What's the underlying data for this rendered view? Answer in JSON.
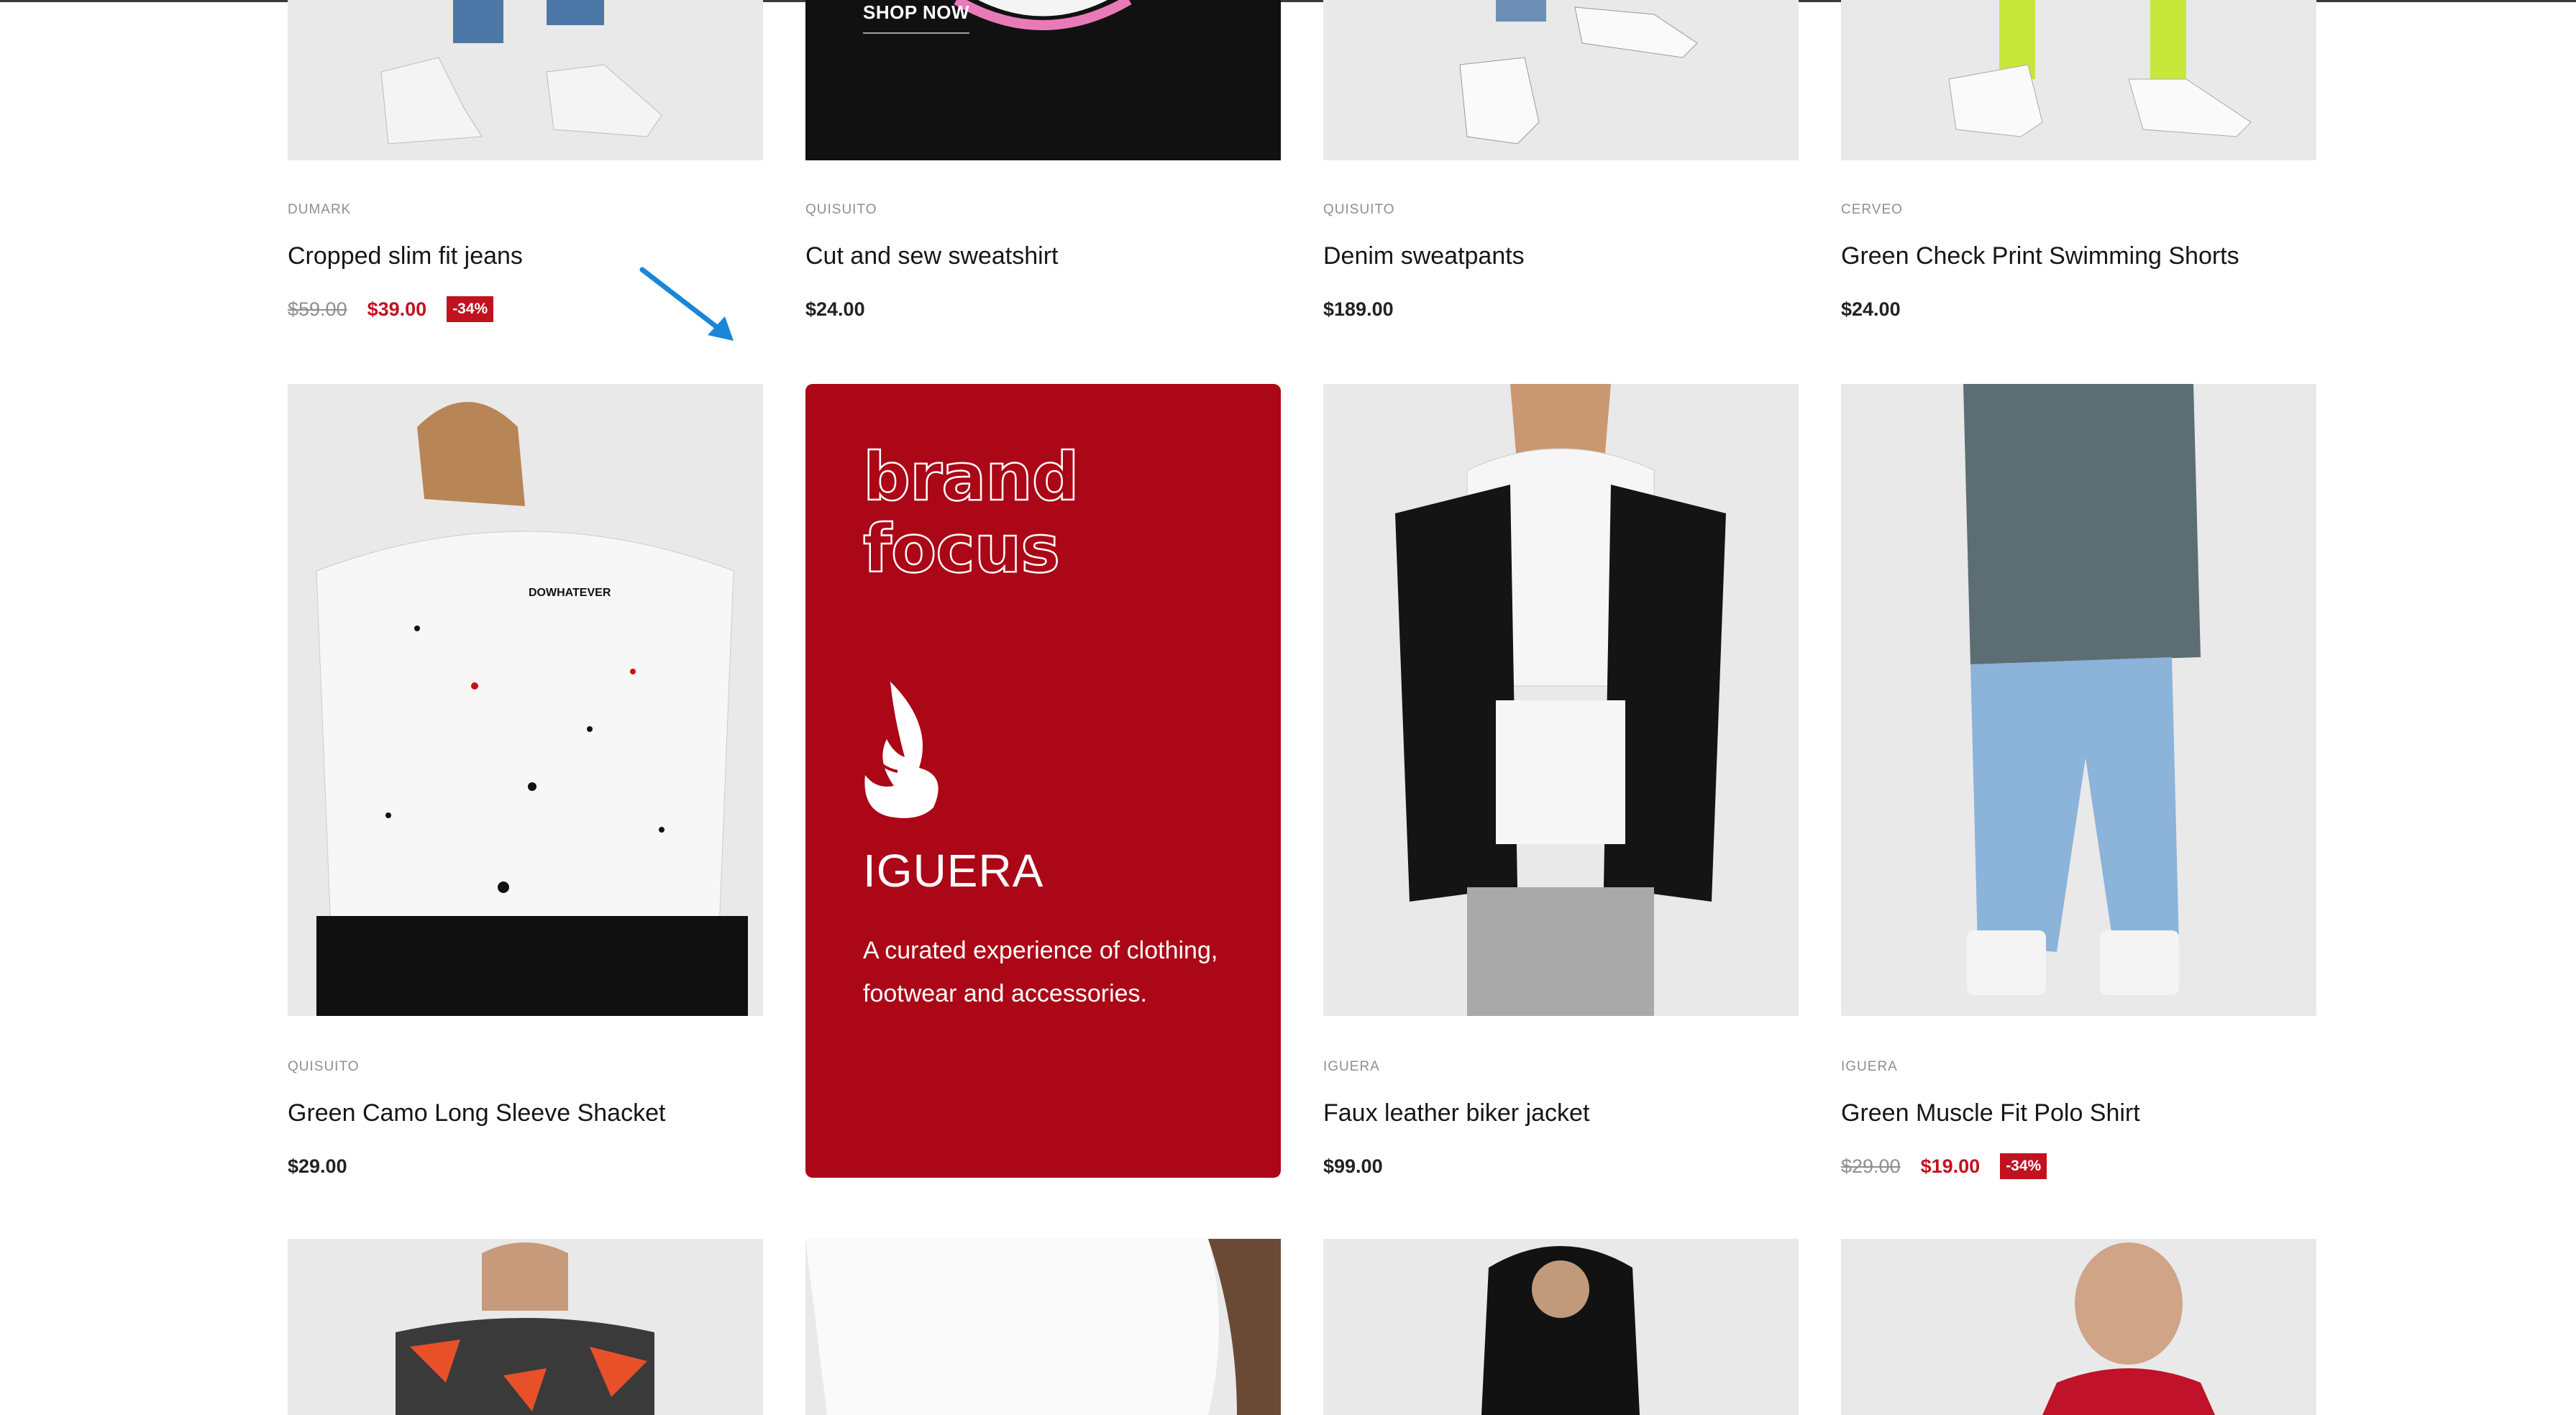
{
  "row1": [
    {
      "brand": "DUMARK",
      "title": "Cropped slim fit jeans",
      "old_price": "$59.00",
      "price": "$39.00",
      "badge": "-34%"
    },
    {
      "brand": "QUISUITO",
      "title": "Cut and sew sweatshirt",
      "price": "$24.00"
    },
    {
      "brand": "QUISUITO",
      "title": "Denim sweatpants",
      "price": "$189.00"
    },
    {
      "brand": "CERVEO",
      "title": "Green Check Print Swimming Shorts",
      "price": "$24.00"
    }
  ],
  "row2": [
    {
      "brand": "QUISUITO",
      "title": "Green Camo Long Sleeve Shacket",
      "price": "$29.00"
    },
    {
      "brand": "IGUERA",
      "title": "Faux leather biker jacket",
      "price": "$99.00"
    },
    {
      "brand": "IGUERA",
      "title": "Green Muscle Fit Polo Shirt",
      "old_price": "$29.00",
      "price": "$19.00",
      "badge": "-34%"
    }
  ],
  "promo": {
    "headline_line1": "brand",
    "headline_line2": "focus",
    "brand_name": "IGUERA",
    "description": "A curated experience of clothing, footwear and accessories.",
    "cta": "SHOP NOW",
    "logo_icon": "phoenix-icon"
  },
  "annotation": {
    "icon": "arrow-icon",
    "color": "#1a86d9"
  },
  "colors": {
    "accent": "#c1121f",
    "promo_bg": "#ab0717"
  }
}
